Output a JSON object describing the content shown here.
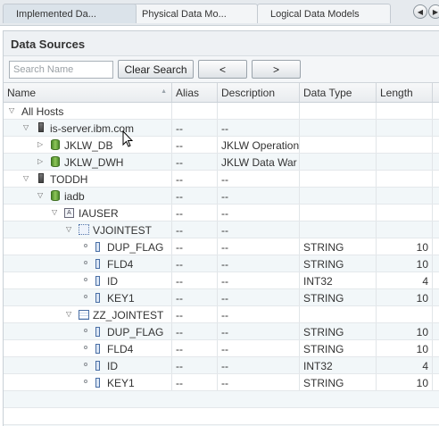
{
  "tabs": [
    {
      "label": "Implemented Da...",
      "active": true
    },
    {
      "label": "Physical Data Mo...",
      "active": false
    },
    {
      "label": "Logical Data Models",
      "active": false
    }
  ],
  "panel": {
    "title": "Data Sources",
    "search_placeholder": "Search Name",
    "clear_label": "Clear Search",
    "prev_label": "<",
    "next_label": ">"
  },
  "columns": [
    "Name",
    "Alias",
    "Description",
    "Data Type",
    "Length"
  ],
  "rows": [
    {
      "name": "All Hosts",
      "alias": "",
      "desc": "",
      "type": "",
      "len": "",
      "level": 0,
      "icon": "none",
      "toggle": "expanded"
    },
    {
      "name": "is-server.ibm.com",
      "alias": "--",
      "desc": "--",
      "type": "",
      "len": "",
      "level": 1,
      "icon": "server-icon",
      "toggle": "expanded"
    },
    {
      "name": "JKLW_DB",
      "alias": "--",
      "desc": "JKLW Operation",
      "type": "",
      "len": "",
      "level": 2,
      "icon": "database-icon",
      "toggle": "collapsed"
    },
    {
      "name": "JKLW_DWH",
      "alias": "--",
      "desc": "JKLW Data War",
      "type": "",
      "len": "",
      "level": 2,
      "icon": "database-icon",
      "toggle": "collapsed"
    },
    {
      "name": "TODDH",
      "alias": "--",
      "desc": "--",
      "type": "",
      "len": "",
      "level": 1,
      "icon": "server-icon",
      "toggle": "expanded"
    },
    {
      "name": "iadb",
      "alias": "--",
      "desc": "--",
      "type": "",
      "len": "",
      "level": 2,
      "icon": "database-icon",
      "toggle": "expanded"
    },
    {
      "name": "IAUSER",
      "alias": "--",
      "desc": "--",
      "type": "",
      "len": "",
      "level": 3,
      "icon": "schema-icon",
      "toggle": "expanded"
    },
    {
      "name": "VJOINTEST",
      "alias": "--",
      "desc": "--",
      "type": "",
      "len": "",
      "level": 4,
      "icon": "view-icon",
      "toggle": "expanded"
    },
    {
      "name": "DUP_FLAG",
      "alias": "--",
      "desc": "--",
      "type": "STRING",
      "len": "10",
      "level": 5,
      "icon": "column-icon",
      "toggle": "leaf"
    },
    {
      "name": "FLD4",
      "alias": "--",
      "desc": "--",
      "type": "STRING",
      "len": "10",
      "level": 5,
      "icon": "column-icon",
      "toggle": "leaf"
    },
    {
      "name": "ID",
      "alias": "--",
      "desc": "--",
      "type": "INT32",
      "len": "4",
      "level": 5,
      "icon": "column-icon",
      "toggle": "leaf"
    },
    {
      "name": "KEY1",
      "alias": "--",
      "desc": "--",
      "type": "STRING",
      "len": "10",
      "level": 5,
      "icon": "column-icon",
      "toggle": "leaf"
    },
    {
      "name": "ZZ_JOINTEST",
      "alias": "--",
      "desc": "--",
      "type": "",
      "len": "",
      "level": 4,
      "icon": "table-icon",
      "toggle": "expanded"
    },
    {
      "name": "DUP_FLAG",
      "alias": "--",
      "desc": "--",
      "type": "STRING",
      "len": "10",
      "level": 5,
      "icon": "column-icon",
      "toggle": "leaf"
    },
    {
      "name": "FLD4",
      "alias": "--",
      "desc": "--",
      "type": "STRING",
      "len": "10",
      "level": 5,
      "icon": "column-icon",
      "toggle": "leaf"
    },
    {
      "name": "ID",
      "alias": "--",
      "desc": "--",
      "type": "INT32",
      "len": "4",
      "level": 5,
      "icon": "column-icon",
      "toggle": "leaf"
    },
    {
      "name": "KEY1",
      "alias": "--",
      "desc": "--",
      "type": "STRING",
      "len": "10",
      "level": 5,
      "icon": "column-icon",
      "toggle": "leaf"
    }
  ]
}
